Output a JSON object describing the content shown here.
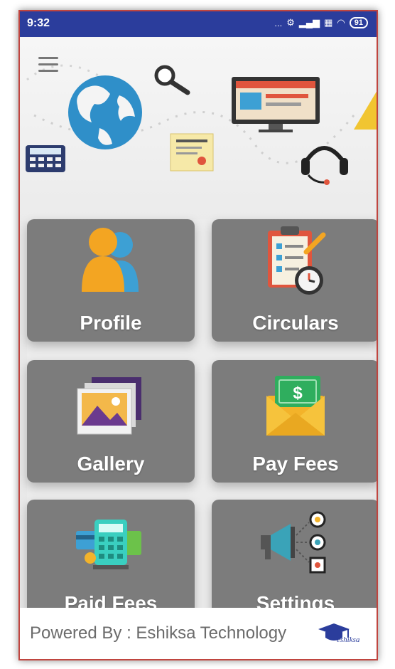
{
  "status_bar": {
    "time": "9:32",
    "dots": "...",
    "battery": "91"
  },
  "menu": {
    "tiles": [
      {
        "label": "Profile",
        "icon": "profile-icon"
      },
      {
        "label": "Circulars",
        "icon": "circulars-icon"
      },
      {
        "label": "Gallery",
        "icon": "gallery-icon"
      },
      {
        "label": "Pay Fees",
        "icon": "pay-fees-icon"
      },
      {
        "label": "Paid Fees",
        "icon": "paid-fees-icon"
      },
      {
        "label": "Settings",
        "icon": "settings-icon"
      }
    ]
  },
  "footer": {
    "powered_by": "Powered By : Eshiksa Technology",
    "logo_text": "eshiksa"
  },
  "colors": {
    "status_bar": "#2b3d9c",
    "tile": "#7c7c7c",
    "border": "#c0453f"
  }
}
